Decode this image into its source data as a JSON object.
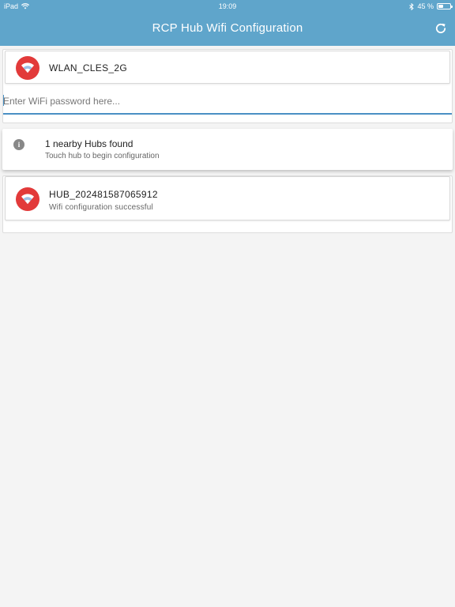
{
  "status_bar": {
    "device": "iPad",
    "time": "19:09",
    "battery_text": "45 %",
    "battery_level": 0.45
  },
  "header": {
    "title": "RCP Hub Wifi Configuration",
    "refresh_icon": "refresh-icon"
  },
  "network": {
    "ssid": "WLAN_CLES_2G",
    "icon": "wifi-icon"
  },
  "password": {
    "value": "",
    "placeholder": "Enter WiFi password here..."
  },
  "scan_result": {
    "icon": "info-icon",
    "title": "1 nearby Hubs found",
    "subtitle": "Touch hub to begin configuration"
  },
  "hubs": [
    {
      "name": "HUB_202481587065912",
      "status": "Wifi configuration successful",
      "icon": "wifi-icon"
    }
  ],
  "colors": {
    "header": "#5fa5cb",
    "accent_red": "#e23a3a",
    "input_underline": "#4a90c4"
  }
}
